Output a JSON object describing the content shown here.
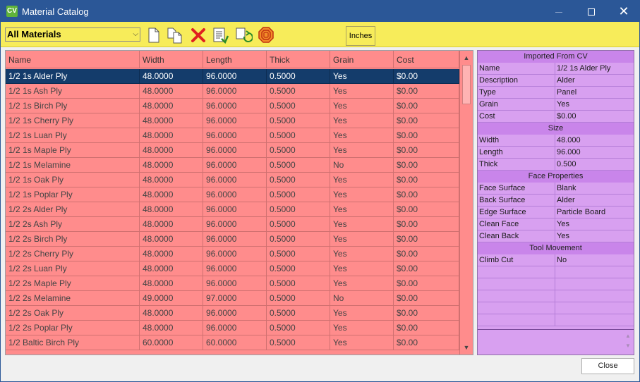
{
  "window": {
    "title": "Material Catalog",
    "app_icon_text": "CV",
    "controls": {
      "minimize": "minimize",
      "maximize": "maximize",
      "close": "✕"
    }
  },
  "toolbar": {
    "filter": {
      "selected": "All Materials"
    },
    "buttons": [
      "new-document-icon",
      "copy-document-icon",
      "delete-icon",
      "export-icon",
      "refresh-icon",
      "stop-icon"
    ],
    "units_label": "Inches",
    "colors": {
      "background": "#f7ec5a",
      "delete": "#e02020"
    }
  },
  "grid": {
    "columns": [
      "Name",
      "Width",
      "Length",
      "Thick",
      "Grain",
      "Cost"
    ],
    "selected_index": 0,
    "rows": [
      [
        "1/2 1s Alder Ply",
        "48.0000",
        "96.0000",
        "0.5000",
        "Yes",
        "$0.00"
      ],
      [
        "1/2 1s Ash Ply",
        "48.0000",
        "96.0000",
        "0.5000",
        "Yes",
        "$0.00"
      ],
      [
        "1/2 1s Birch Ply",
        "48.0000",
        "96.0000",
        "0.5000",
        "Yes",
        "$0.00"
      ],
      [
        "1/2 1s Cherry Ply",
        "48.0000",
        "96.0000",
        "0.5000",
        "Yes",
        "$0.00"
      ],
      [
        "1/2 1s Luan Ply",
        "48.0000",
        "96.0000",
        "0.5000",
        "Yes",
        "$0.00"
      ],
      [
        "1/2 1s Maple Ply",
        "48.0000",
        "96.0000",
        "0.5000",
        "Yes",
        "$0.00"
      ],
      [
        "1/2 1s Melamine",
        "48.0000",
        "96.0000",
        "0.5000",
        "No",
        "$0.00"
      ],
      [
        "1/2 1s Oak Ply",
        "48.0000",
        "96.0000",
        "0.5000",
        "Yes",
        "$0.00"
      ],
      [
        "1/2 1s Poplar Ply",
        "48.0000",
        "96.0000",
        "0.5000",
        "Yes",
        "$0.00"
      ],
      [
        "1/2 2s Alder Ply",
        "48.0000",
        "96.0000",
        "0.5000",
        "Yes",
        "$0.00"
      ],
      [
        "1/2 2s Ash Ply",
        "48.0000",
        "96.0000",
        "0.5000",
        "Yes",
        "$0.00"
      ],
      [
        "1/2 2s Birch Ply",
        "48.0000",
        "96.0000",
        "0.5000",
        "Yes",
        "$0.00"
      ],
      [
        "1/2 2s Cherry Ply",
        "48.0000",
        "96.0000",
        "0.5000",
        "Yes",
        "$0.00"
      ],
      [
        "1/2 2s Luan Ply",
        "48.0000",
        "96.0000",
        "0.5000",
        "Yes",
        "$0.00"
      ],
      [
        "1/2 2s Maple Ply",
        "48.0000",
        "96.0000",
        "0.5000",
        "Yes",
        "$0.00"
      ],
      [
        "1/2 2s Melamine",
        "49.0000",
        "97.0000",
        "0.5000",
        "No",
        "$0.00"
      ],
      [
        "1/2 2s Oak Ply",
        "48.0000",
        "96.0000",
        "0.5000",
        "Yes",
        "$0.00"
      ],
      [
        "1/2 2s Poplar Ply",
        "48.0000",
        "96.0000",
        "0.5000",
        "Yes",
        "$0.00"
      ],
      [
        "1/2 Baltic Birch Ply",
        "60.0000",
        "60.0000",
        "0.5000",
        "Yes",
        "$0.00"
      ]
    ],
    "colors": {
      "background": "#ff8c8c",
      "selected": "#143c6b"
    }
  },
  "properties": {
    "sections": [
      {
        "title": "Imported From CV",
        "rows": [
          {
            "key": "Name",
            "value": "1/2 1s Alder Ply"
          },
          {
            "key": "Description",
            "value": "Alder"
          },
          {
            "key": "Type",
            "value": "Panel"
          },
          {
            "key": "Grain",
            "value": "Yes"
          },
          {
            "key": "Cost",
            "value": "$0.00"
          }
        ]
      },
      {
        "title": "Size",
        "rows": [
          {
            "key": "Width",
            "value": "48.000"
          },
          {
            "key": "Length",
            "value": "96.000"
          },
          {
            "key": "Thick",
            "value": "0.500"
          }
        ]
      },
      {
        "title": "Face Properties",
        "rows": [
          {
            "key": "Face Surface",
            "value": "Blank"
          },
          {
            "key": "Back Surface",
            "value": "Alder"
          },
          {
            "key": "Edge Surface",
            "value": "Particle Board"
          },
          {
            "key": "Clean Face",
            "value": "Yes"
          },
          {
            "key": "Clean Back",
            "value": "Yes"
          }
        ]
      },
      {
        "title": "Tool Movement",
        "rows": [
          {
            "key": "Climb Cut",
            "value": "No"
          }
        ]
      }
    ],
    "colors": {
      "background": "#d8a0f0",
      "section": "#c985ea"
    }
  },
  "footer": {
    "close_label": "Close"
  }
}
